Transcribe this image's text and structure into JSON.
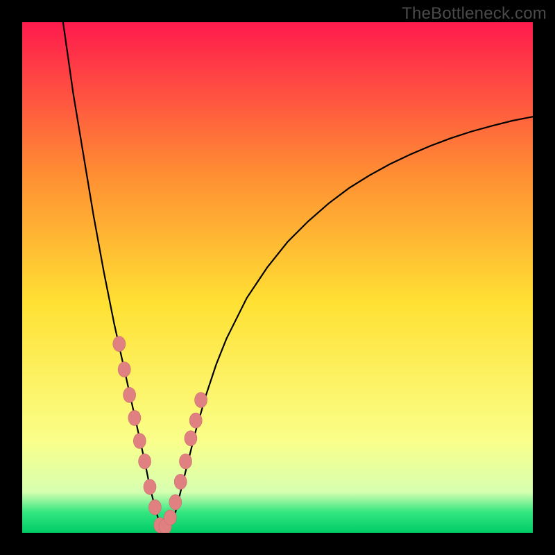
{
  "watermark": "TheBottleneck.com",
  "colors": {
    "frame_bg": "#000000",
    "curve": "#000000",
    "marker_fill": "#e08080",
    "marker_stroke": "#c86e6e",
    "gradient": {
      "top": "#ff1a4d",
      "mid_upper": "#ff9933",
      "mid": "#ffe133",
      "lower_yellow": "#faff8a",
      "green_light": "#b3ff66",
      "green": "#33e680",
      "green_deep": "#00cc66"
    }
  },
  "chart_data": {
    "type": "line",
    "title": "",
    "subtitle": "",
    "xlabel": "",
    "ylabel": "",
    "xlim": [
      0,
      100
    ],
    "ylim": [
      0,
      100
    ],
    "grid": false,
    "legend": false,
    "series": [
      {
        "name": "bottleneck-curve",
        "note": "V-shaped curve; minimum near x≈27, left arm steep, right arm asymptotic",
        "x": [
          8,
          10,
          12,
          14,
          16,
          18,
          20,
          22,
          24,
          25,
          26,
          27,
          28,
          29,
          30,
          31,
          32,
          34,
          36,
          38,
          40,
          44,
          48,
          52,
          56,
          60,
          64,
          68,
          72,
          76,
          80,
          84,
          88,
          92,
          96,
          100
        ],
        "y": [
          100,
          86,
          74,
          62,
          51,
          41,
          32,
          23,
          14,
          9,
          5,
          1.5,
          1,
          1.5,
          4,
          8,
          12,
          20,
          27,
          33,
          38,
          46,
          52,
          57,
          61,
          64.5,
          67.5,
          70,
          72.2,
          74.1,
          75.8,
          77.3,
          78.6,
          79.7,
          80.7,
          81.5
        ]
      }
    ],
    "markers": {
      "name": "highlighted-points",
      "note": "salmon dots along lower portion of both arms and trough",
      "x": [
        19,
        20,
        21,
        22,
        23,
        24,
        25,
        26,
        27,
        28,
        29,
        30,
        31,
        32,
        33,
        34,
        35
      ],
      "y": [
        37,
        32,
        27,
        22.5,
        18,
        14,
        9,
        5,
        1.5,
        1.2,
        3,
        6,
        10,
        14,
        18.5,
        22,
        26
      ]
    }
  }
}
